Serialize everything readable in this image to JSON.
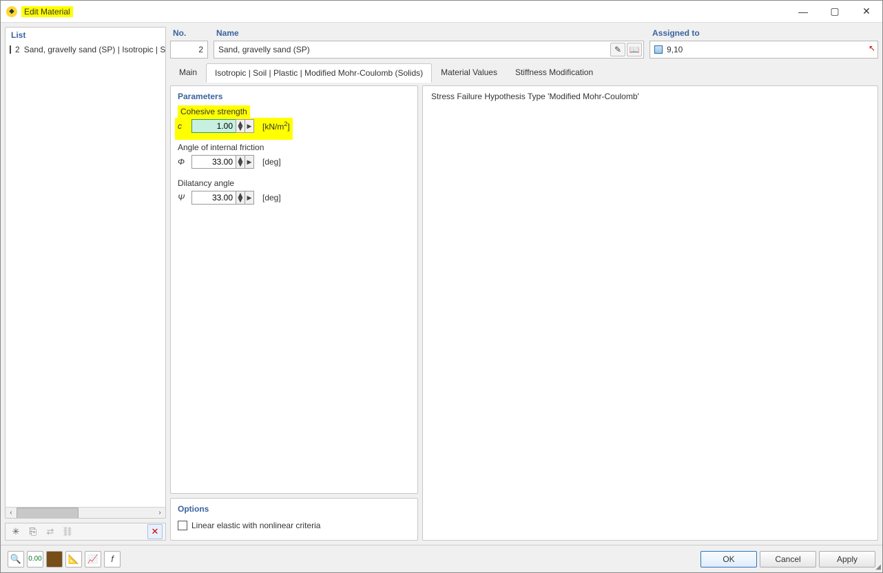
{
  "window": {
    "title": "Edit Material"
  },
  "list": {
    "header": "List",
    "items": [
      {
        "num": "2",
        "label": "Sand, gravelly sand (SP) | Isotropic | S"
      }
    ]
  },
  "header_fields": {
    "no_label": "No.",
    "no_value": "2",
    "name_label": "Name",
    "name_value": "Sand, gravelly sand (SP)",
    "assigned_label": "Assigned to",
    "assigned_value": "9,10"
  },
  "tabs": [
    {
      "id": "main",
      "label": "Main"
    },
    {
      "id": "iso",
      "label": "Isotropic | Soil | Plastic | Modified Mohr-Coulomb (Solids)"
    },
    {
      "id": "mv",
      "label": "Material Values"
    },
    {
      "id": "sm",
      "label": "Stiffness Modification"
    }
  ],
  "active_tab": "iso",
  "parameters": {
    "section": "Parameters",
    "cohesive": {
      "title": "Cohesive strength",
      "symbol": "c",
      "value": "1.00",
      "unit_html": "[kN/m²]"
    },
    "friction": {
      "title": "Angle of internal friction",
      "symbol": "Φ",
      "value": "33.00",
      "unit": "[deg]"
    },
    "dilatancy": {
      "title": "Dilatancy angle",
      "symbol": "Ψ",
      "value": "33.00",
      "unit": "[deg]"
    }
  },
  "options": {
    "section": "Options",
    "linear_elastic": "Linear elastic with nonlinear criteria"
  },
  "info_text": "Stress Failure Hypothesis Type 'Modified Mohr-Coulomb'",
  "footer": {
    "ok": "OK",
    "cancel": "Cancel",
    "apply": "Apply"
  }
}
